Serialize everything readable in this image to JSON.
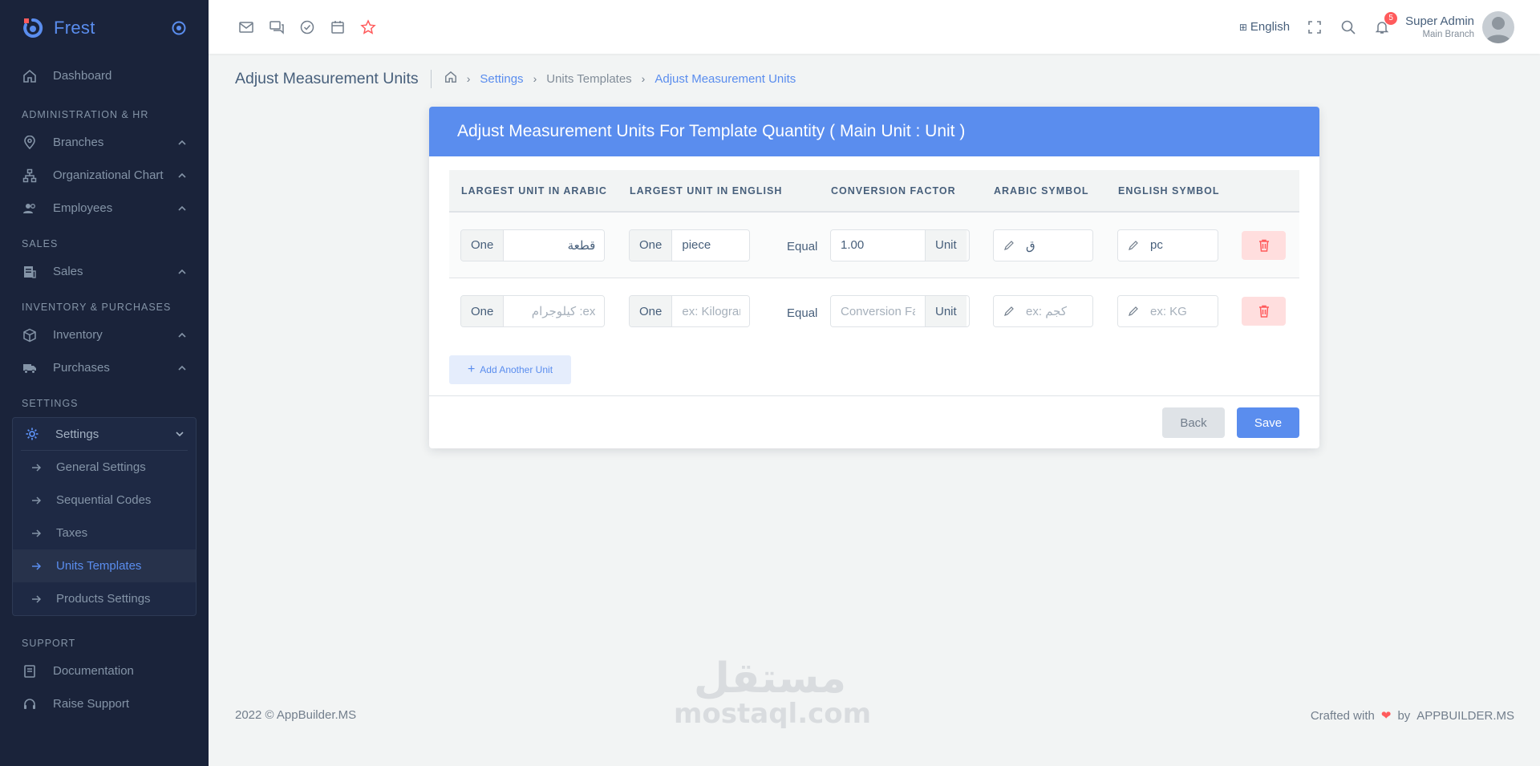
{
  "brand": {
    "name": "Frest"
  },
  "sidebar": {
    "dashboard": "Dashboard",
    "sections": {
      "admin": "ADMINISTRATION & HR",
      "sales": "SALES",
      "inventory": "INVENTORY & PURCHASES",
      "settings": "SETTINGS",
      "support": "SUPPORT"
    },
    "items": {
      "branches": "Branches",
      "org_chart": "Organizational Chart",
      "employees": "Employees",
      "sales": "Sales",
      "inventory": "Inventory",
      "purchases": "Purchases",
      "settings": "Settings",
      "documentation": "Documentation",
      "raise_support": "Raise Support"
    },
    "settings_sub": {
      "general": "General Settings",
      "sequential": "Sequential Codes",
      "taxes": "Taxes",
      "units": "Units Templates",
      "products": "Products Settings"
    }
  },
  "topbar": {
    "language": "English",
    "notifications_count": "5",
    "user_name": "Super Admin",
    "user_branch": "Main Branch"
  },
  "page": {
    "title": "Adjust Measurement Units",
    "breadcrumb": {
      "settings": "Settings",
      "units_templates": "Units Templates",
      "current": "Adjust Measurement Units"
    }
  },
  "card": {
    "header": "Adjust Measurement Units For Template Quantity ( Main Unit : Unit )",
    "columns": {
      "arabic": "LARGEST UNIT IN ARABIC",
      "english": "LARGEST UNIT IN ENGLISH",
      "factor": "CONVERSION FACTOR",
      "ar_symbol": "ARABIC SYMBOL",
      "en_symbol": "ENGLISH SYMBOL"
    },
    "labels": {
      "one": "One",
      "equal": "Equal",
      "unit": "Unit"
    },
    "rows": [
      {
        "arabic": "قطعة",
        "english": "piece",
        "factor": "1.00",
        "ar_symbol": "ق",
        "en_symbol": "pc"
      }
    ],
    "placeholders": {
      "arabic": "ex: كيلوجرام",
      "english": "ex: Kilogram",
      "factor": "Conversion Factor",
      "ar_symbol": "ex: كجم",
      "en_symbol": "ex: KG"
    },
    "add_unit": "Add Another Unit",
    "back": "Back",
    "save": "Save"
  },
  "footer": {
    "copyright": "2022 © AppBuilder.MS",
    "crafted": "Crafted with",
    "by": "by",
    "brand": "APPBUILDER.MS"
  },
  "watermark": {
    "arabic": "مستقل",
    "latin": "mostaql.com"
  },
  "colors": {
    "primary": "#5a8dee",
    "sidebar": "#1a233a",
    "danger": "#ff5b5c"
  }
}
